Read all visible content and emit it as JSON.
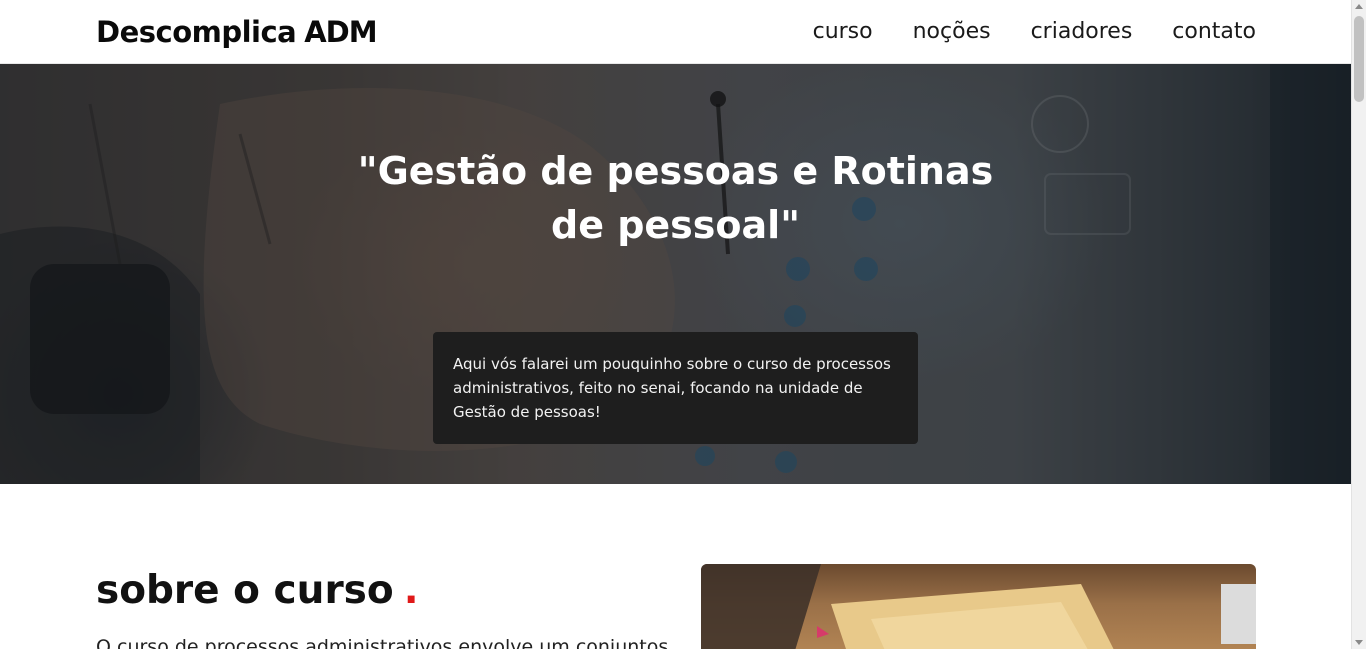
{
  "header": {
    "logo_text": "Descomplica",
    "logo_accent": "ADM",
    "nav": [
      {
        "label": "curso"
      },
      {
        "label": "noções"
      },
      {
        "label": "criadores"
      },
      {
        "label": "contato"
      }
    ]
  },
  "hero": {
    "title": "\"Gestão de pessoas e Rotinas de pessoal\"",
    "card_text": "Aqui vós falarei um pouquinho sobre o curso de processos administrativos, feito no senai, focando na unidade de Gestão de pessoas!"
  },
  "about": {
    "title": "sobre o curso",
    "title_dot": ".",
    "text": "O curso de processos administrativos envolve um conjuntos"
  },
  "colors": {
    "accent_dot": "#e01919",
    "hero_card_bg": "#1e1e1e",
    "text": "#111111"
  }
}
